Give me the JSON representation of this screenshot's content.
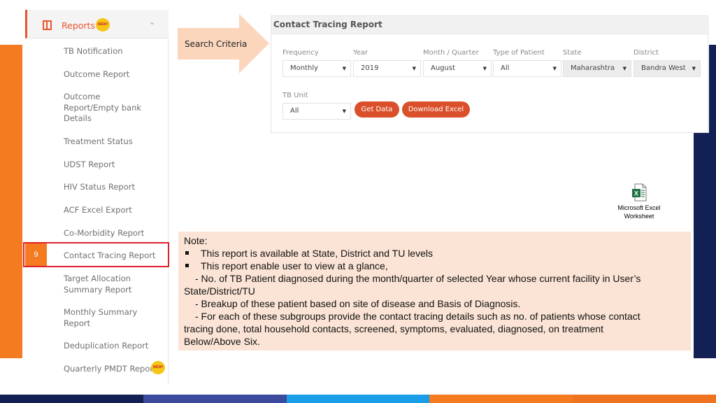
{
  "sidebar": {
    "header": {
      "label": "Reports",
      "badge": "NEW!"
    },
    "items": [
      {
        "label": "TB Notification"
      },
      {
        "label": "Outcome Report"
      },
      {
        "label": "Outcome Report/Empty bank Details"
      },
      {
        "label": "Treatment Status"
      },
      {
        "label": "UDST Report"
      },
      {
        "label": "HIV Status Report"
      },
      {
        "label": "ACF Excel Export"
      },
      {
        "label": "Co-Morbidity Report"
      },
      {
        "label": "Contact Tracing Report"
      },
      {
        "label": "Target Allocation Summary Report"
      },
      {
        "label": "Monthly Summary Report"
      },
      {
        "label": "Deduplication Report"
      },
      {
        "label": "Quarterly PMDT Report",
        "badge": "NEW!"
      }
    ],
    "active_number": "9"
  },
  "callout": {
    "label": "Search Criteria"
  },
  "report": {
    "title": "Contact Tracing Report",
    "filters": [
      {
        "label": "Frequency",
        "value": "Monthly"
      },
      {
        "label": "Year",
        "value": "2019"
      },
      {
        "label": "Month / Quarter",
        "value": "August"
      },
      {
        "label": "Type of Patient",
        "value": "All"
      },
      {
        "label": "State",
        "value": "Maharashtra"
      },
      {
        "label": "District",
        "value": "Bandra West"
      },
      {
        "label": "TB Unit",
        "value": "All"
      }
    ],
    "get_data_label": "Get Data",
    "download_label": "Download Excel"
  },
  "attachment": {
    "label_line1": "Microsoft Excel",
    "label_line2": "Worksheet",
    "icon": "excel-icon"
  },
  "note": {
    "heading": "Note:",
    "lines": [
      "This report is available at State, District and TU levels",
      "This report enable user to view at a glance,",
      "- No. of TB Patient diagnosed during the month/quarter of selected Year whose current facility in User’s",
      "State/District/TU",
      "- Breakup of these patient based on site of disease and Basis of Diagnosis.",
      "- For each of these subgroups provide the contact tracing details such as no. of patients whose contact",
      "tracing done, total household contacts, screened, symptoms, evaluated, diagnosed, on treatment",
      "Below/Above Six."
    ]
  },
  "colors": {
    "accent": "#f47b20",
    "brand_red": "#d9502a",
    "navy": "#132054",
    "highlight": "#e0202e",
    "note_bg": "#fbe4d5",
    "footer": [
      "#132054",
      "#3b4a9c",
      "#1b9ee8",
      "#f47b20",
      "#ee7422"
    ]
  }
}
